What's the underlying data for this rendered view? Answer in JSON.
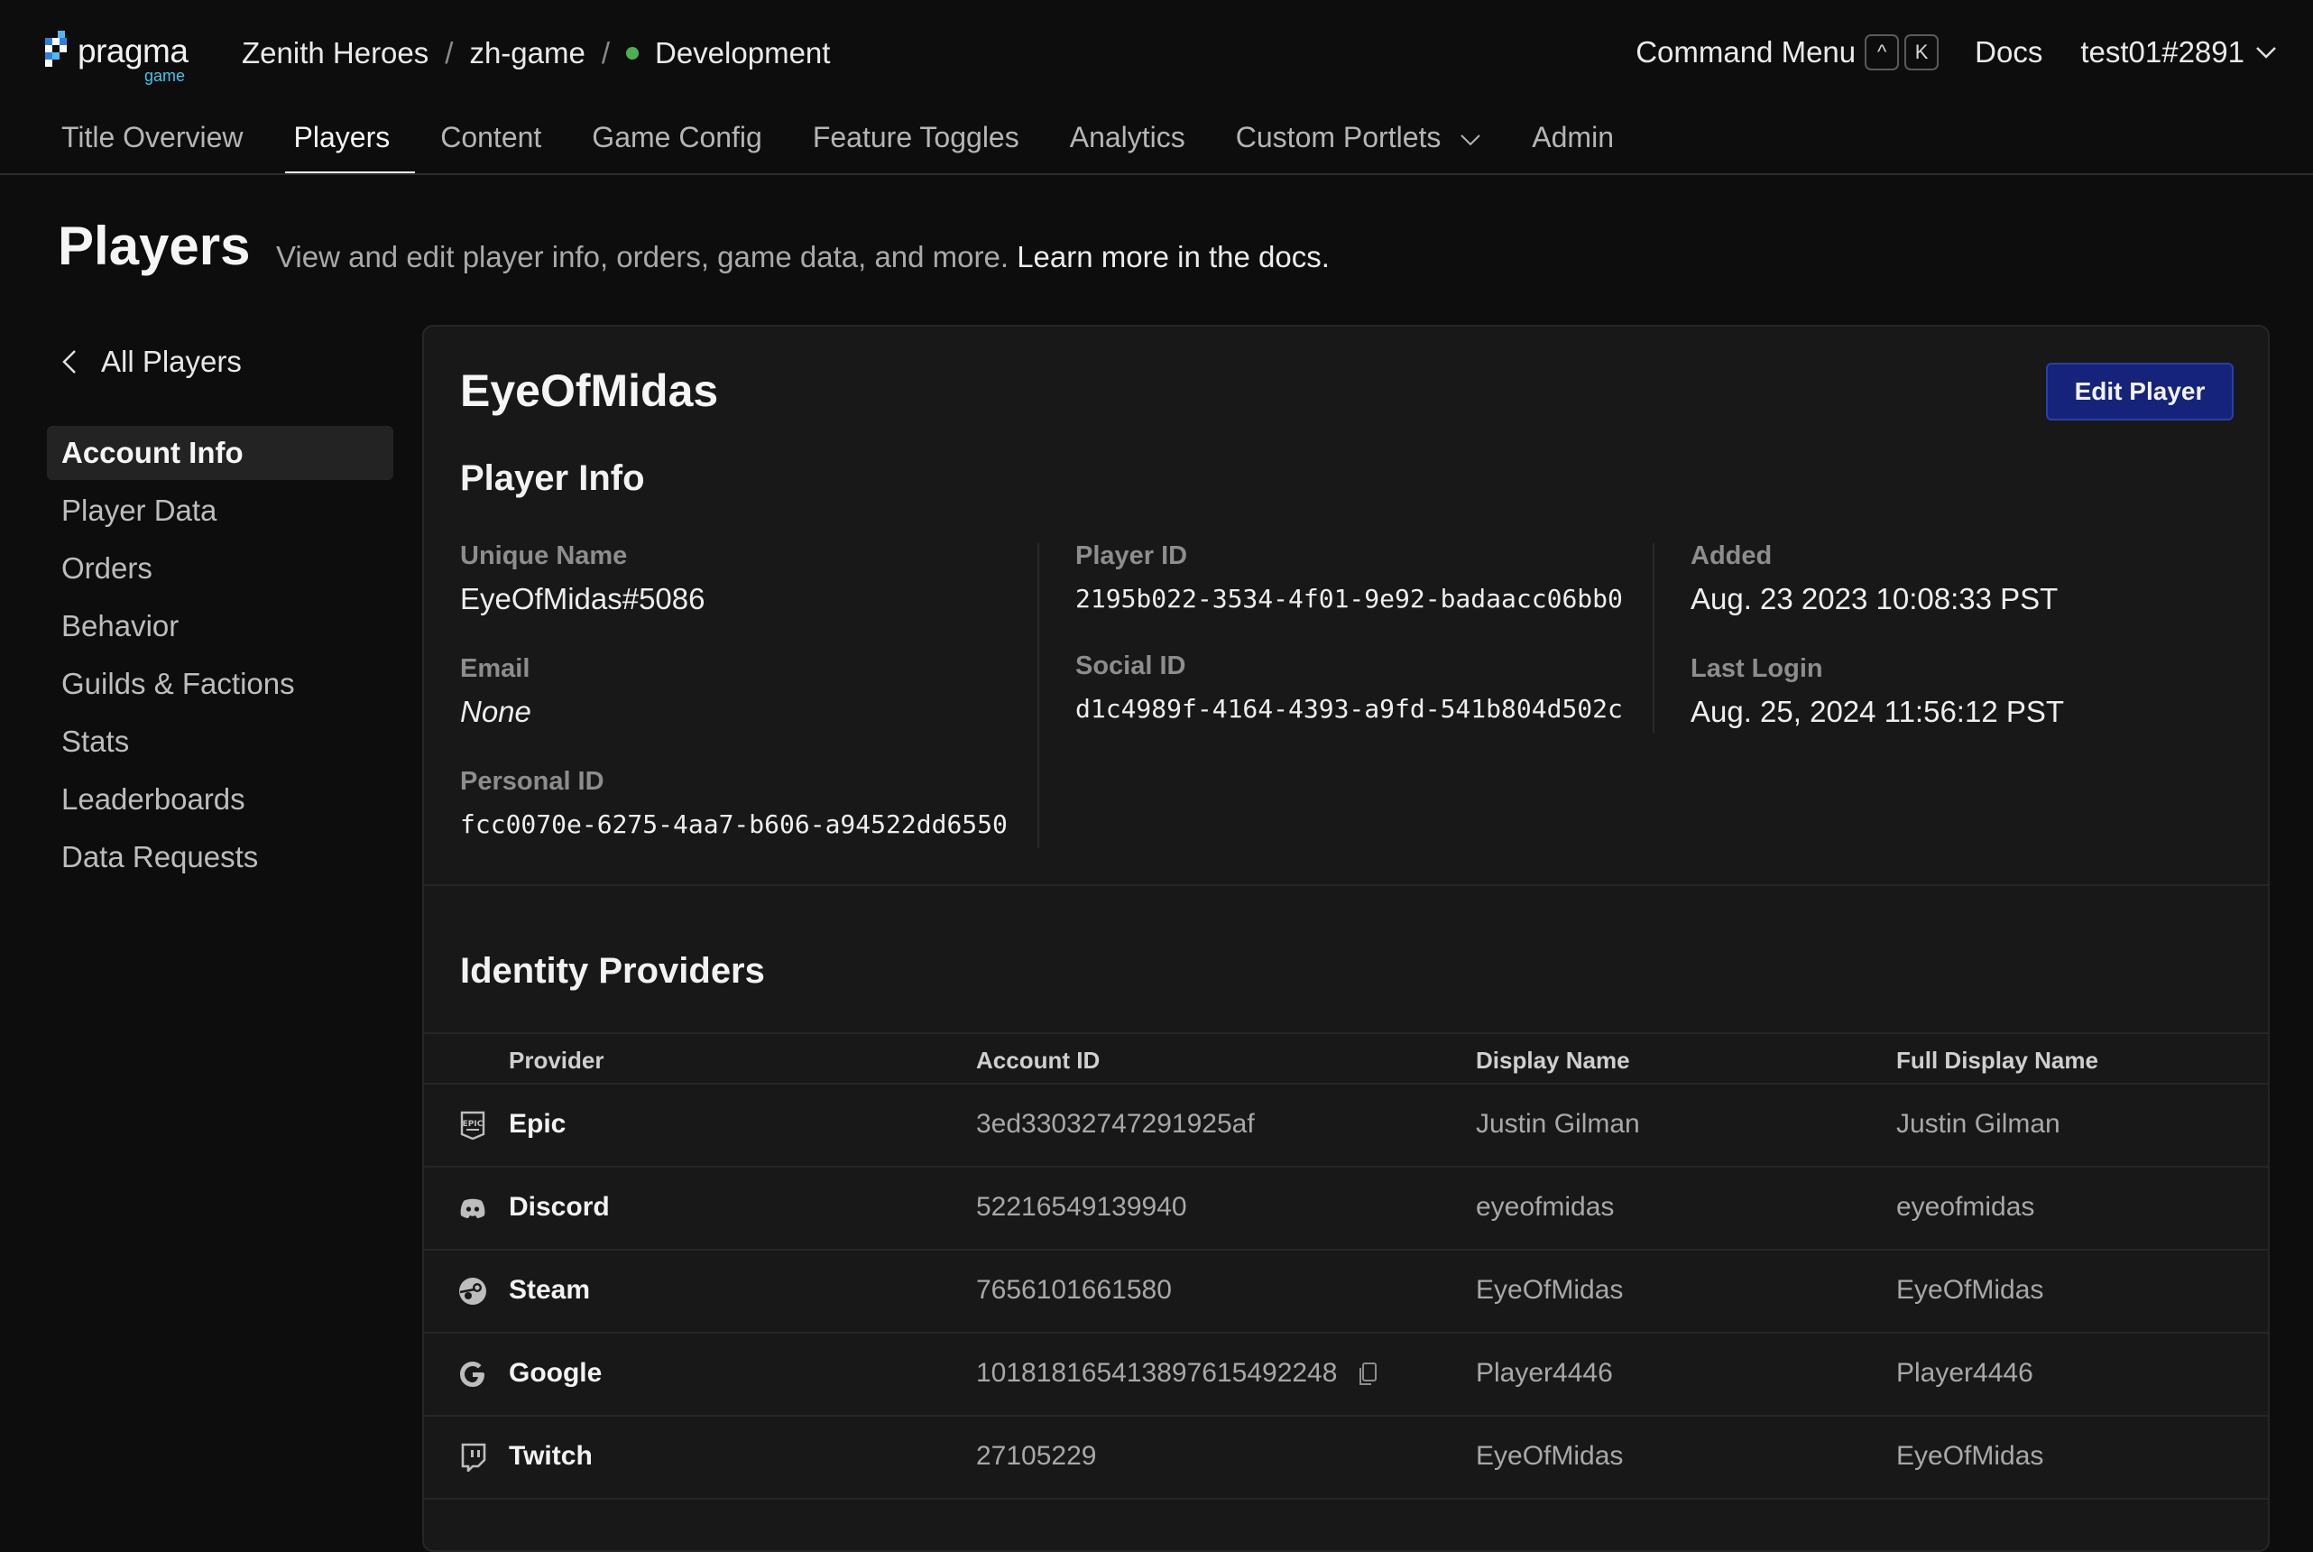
{
  "app": {
    "logo_text": "pragma",
    "logo_sub": "game"
  },
  "breadcrumb": {
    "title": "Zenith Heroes",
    "game": "zh-game",
    "environment": "Development",
    "environment_color": "#4caf50"
  },
  "topbar": {
    "command_menu": "Command Menu",
    "kbd_ctrl": "^",
    "kbd_k": "K",
    "docs": "Docs",
    "user": "test01#2891"
  },
  "tabs": [
    {
      "label": "Title Overview"
    },
    {
      "label": "Players",
      "active": true
    },
    {
      "label": "Content"
    },
    {
      "label": "Game Config"
    },
    {
      "label": "Feature Toggles"
    },
    {
      "label": "Analytics"
    },
    {
      "label": "Custom Portlets"
    },
    {
      "label": "Admin"
    }
  ],
  "page": {
    "title": "Players",
    "subtitle": "View and edit player info, orders, game data, and more.",
    "docs_link": "Learn more in the docs."
  },
  "sidebar": {
    "back_label": "All Players",
    "items": [
      {
        "label": "Account Info",
        "active": true
      },
      {
        "label": "Player Data"
      },
      {
        "label": "Orders"
      },
      {
        "label": "Behavior"
      },
      {
        "label": "Guilds & Factions"
      },
      {
        "label": "Stats"
      },
      {
        "label": "Leaderboards"
      },
      {
        "label": "Data Requests"
      }
    ]
  },
  "player": {
    "name": "EyeOfMidas",
    "edit_label": "Edit Player",
    "info_title": "Player Info",
    "unique_name_label": "Unique Name",
    "unique_name": "EyeOfMidas#5086",
    "email_label": "Email",
    "email": "None",
    "personal_id_label": "Personal ID",
    "personal_id": "fcc0070e-6275-4aa7-b606-a94522dd6550",
    "player_id_label": "Player ID",
    "player_id": "2195b022-3534-4f01-9e92-badaacc06bb0",
    "social_id_label": "Social ID",
    "social_id": "d1c4989f-4164-4393-a9fd-541b804d502c",
    "added_label": "Added",
    "added": "Aug. 23 2023 10:08:33 PST",
    "last_login_label": "Last Login",
    "last_login": "Aug. 25, 2024 11:56:12 PST"
  },
  "identity": {
    "title": "Identity Providers",
    "headers": {
      "provider": "Provider",
      "account_id": "Account ID",
      "display_name": "Display Name",
      "full_display_name": "Full Display Name"
    },
    "rows": [
      {
        "icon": "epic-icon",
        "provider": "Epic",
        "account_id": "3ed33032747291925af",
        "display_name": "Justin Gilman",
        "full_display_name": "Justin Gilman"
      },
      {
        "icon": "discord-icon",
        "provider": "Discord",
        "account_id": "52216549139940",
        "display_name": "eyeofmidas",
        "full_display_name": "eyeofmidas"
      },
      {
        "icon": "steam-icon",
        "provider": "Steam",
        "account_id": "7656101661580",
        "display_name": "EyeOfMidas",
        "full_display_name": "EyeOfMidas"
      },
      {
        "icon": "google-icon",
        "provider": "Google",
        "account_id": "101818165413897615492248",
        "display_name": "Player4446",
        "full_display_name": "Player4446"
      },
      {
        "icon": "twitch-icon",
        "provider": "Twitch",
        "account_id": "27105229",
        "display_name": "EyeOfMidas",
        "full_display_name": "EyeOfMidas"
      }
    ]
  }
}
